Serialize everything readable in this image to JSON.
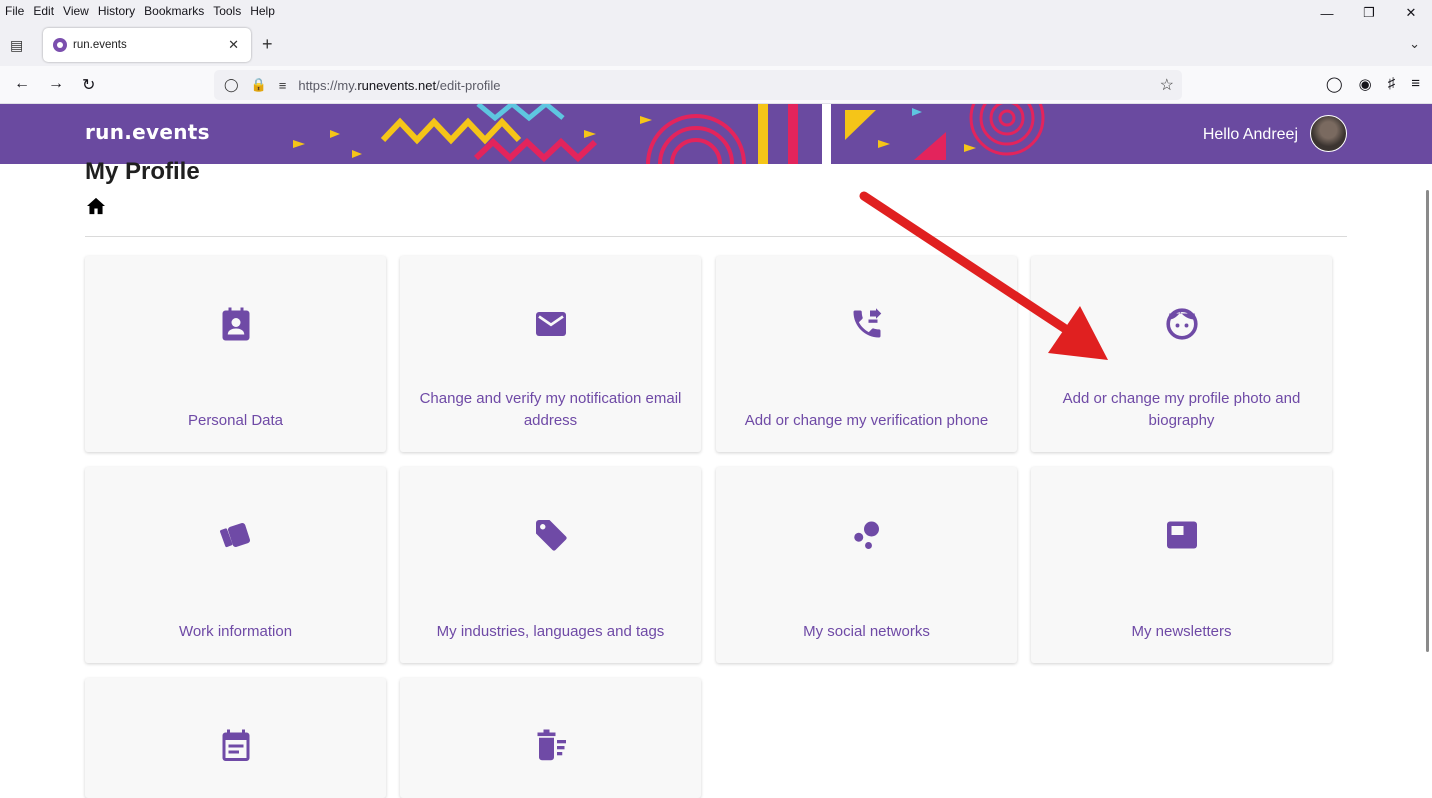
{
  "browser": {
    "menu": [
      "File",
      "Edit",
      "View",
      "History",
      "Bookmarks",
      "Tools",
      "Help"
    ],
    "tab_title": "run.events",
    "url_prefix": "https://my.",
    "url_domain": "runevents.net",
    "url_path": "/edit-profile"
  },
  "header": {
    "logo_text": "run.events",
    "greeting": "Hello Andreej"
  },
  "page": {
    "title": "My Profile"
  },
  "cards": [
    {
      "label": "Personal Data",
      "icon": "contact-card-icon"
    },
    {
      "label": "Change and verify my notification email address",
      "icon": "mail-icon"
    },
    {
      "label": "Add or change my verification phone",
      "icon": "phone-forward-icon"
    },
    {
      "label": "Add or change my profile photo and biography",
      "icon": "face-icon"
    },
    {
      "label": "Work information",
      "icon": "swatches-icon"
    },
    {
      "label": "My industries, languages and tags",
      "icon": "tag-icon"
    },
    {
      "label": "My social networks",
      "icon": "bubbles-icon"
    },
    {
      "label": "My newsletters",
      "icon": "featured-video-icon"
    },
    {
      "label": "",
      "icon": "event-note-icon"
    },
    {
      "label": "",
      "icon": "delete-sweep-icon"
    }
  ],
  "colors": {
    "brand": "#6a4aa0",
    "card_text": "#6f4aa6",
    "annotation_arrow": "#e02020"
  }
}
